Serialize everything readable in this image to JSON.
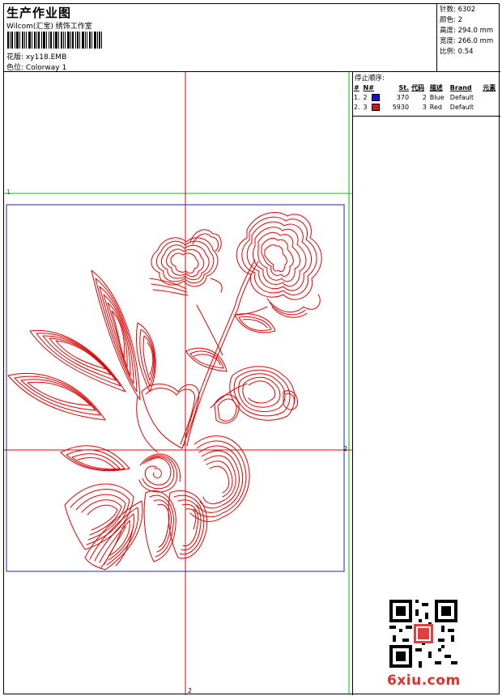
{
  "header": {
    "title": "生产作业图",
    "company": "Wilcom(汇宝) 绣饰工作室",
    "design_label": "花版:",
    "design_value": "xy118.EMB",
    "colorway_label": "色位:",
    "colorway_value": "Colorway 1"
  },
  "stats": [
    {
      "label": "针数:",
      "value": "6302"
    },
    {
      "label": "颜色:",
      "value": "2"
    },
    {
      "label": "高度:",
      "value": "294.0 mm"
    },
    {
      "label": "宽度:",
      "value": "266.0 mm"
    },
    {
      "label": "比例:",
      "value": "0.54"
    }
  ],
  "stop_sequence": {
    "title": "停止顺序:",
    "columns": [
      "#",
      "N#",
      "St.",
      "代码",
      "描述",
      "Brand",
      "元素"
    ],
    "rows": [
      {
        "index": "1.",
        "needle": "2",
        "swatch_color": "#1010e0",
        "stitches": "370",
        "code": "2",
        "description": "Blue",
        "brand": "Default"
      },
      {
        "index": "2.",
        "needle": "3",
        "swatch_color": "#e01010",
        "stitches": "5930",
        "code": "3",
        "description": "Red",
        "brand": "Default"
      }
    ]
  },
  "guides": {
    "label_top": "1",
    "label_right": "2",
    "label_bottom": "2"
  },
  "colors": {
    "embroidery_red": "#e00000",
    "frame_blue": "#2020c0",
    "guide_green": "#00c000",
    "guide_red": "#e00000"
  },
  "watermark": "6xiu.com"
}
